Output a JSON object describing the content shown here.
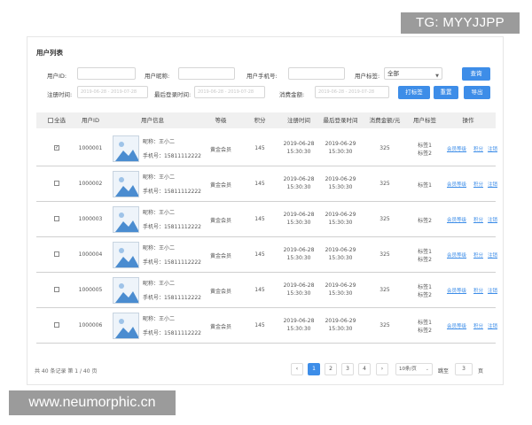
{
  "watermarks": {
    "top": "TG: MYYJJPP",
    "bottom": "www.neumorphic.cn"
  },
  "title": "用户列表",
  "filters": {
    "user_id_label": "用户ID:",
    "nickname_label": "用户昵称:",
    "phone_label": "用户手机号:",
    "tag_label": "用户标签:",
    "tag_value": "全部",
    "register_time_label": "注册时间:",
    "register_time_placeholder": "2019-06-28 - 2019-07-28",
    "last_login_label": "最后登录时间:",
    "last_login_placeholder": "2019-06-28 - 2019-07-28",
    "spend_label": "消费金额:",
    "spend_placeholder": "2019-06-28 - 2019-07-28"
  },
  "buttons": {
    "search": "查询",
    "tag": "打标签",
    "reset": "重置",
    "export": "导出"
  },
  "columns": {
    "select_all": "全选",
    "user_id": "用户ID",
    "user_info": "用户信息",
    "level": "等级",
    "points": "积分",
    "register_time": "注册时间",
    "last_login": "最后登录时间",
    "spend": "消费金额/元",
    "tags": "用户标签",
    "actions": "操作"
  },
  "rows": [
    {
      "checked": true,
      "id": "1000001",
      "nickname": "昵称：王小二",
      "phone": "手机号：15811112222",
      "level": "黄金会员",
      "points": "145",
      "reg_date": "2019-06-28",
      "reg_time": "15:30:30",
      "login_date": "2019-06-29",
      "login_time": "15:30:30",
      "spend": "325",
      "tag1": "标签1",
      "tag2": "标签2"
    },
    {
      "checked": false,
      "id": "1000002",
      "nickname": "昵称：王小二",
      "phone": "手机号：15811112222",
      "level": "黄金会员",
      "points": "145",
      "reg_date": "2019-06-28",
      "reg_time": "15:30:30",
      "login_date": "2019-06-29",
      "login_time": "15:30:30",
      "spend": "325",
      "tag1": "标签1",
      "tag2": ""
    },
    {
      "checked": false,
      "id": "1000003",
      "nickname": "昵称：王小二",
      "phone": "手机号：15811112222",
      "level": "黄金会员",
      "points": "145",
      "reg_date": "2019-06-28",
      "reg_time": "15:30:30",
      "login_date": "2019-06-29",
      "login_time": "15:30:30",
      "spend": "325",
      "tag1": "标签2",
      "tag2": ""
    },
    {
      "checked": false,
      "id": "1000004",
      "nickname": "昵称：王小二",
      "phone": "手机号：15811112222",
      "level": "黄金会员",
      "points": "145",
      "reg_date": "2019-06-28",
      "reg_time": "15:30:30",
      "login_date": "2019-06-29",
      "login_time": "15:30:30",
      "spend": "325",
      "tag1": "标签1",
      "tag2": "标签2"
    },
    {
      "checked": false,
      "id": "1000005",
      "nickname": "昵称：王小二",
      "phone": "手机号：15811112222",
      "level": "黄金会员",
      "points": "145",
      "reg_date": "2019-06-28",
      "reg_time": "15:30:30",
      "login_date": "2019-06-29",
      "login_time": "15:30:30",
      "spend": "325",
      "tag1": "标签1",
      "tag2": "标签2"
    },
    {
      "checked": false,
      "id": "1000006",
      "nickname": "昵称：王小二",
      "phone": "手机号：15811112222",
      "level": "黄金会员",
      "points": "145",
      "reg_date": "2019-06-28",
      "reg_time": "15:30:30",
      "login_date": "2019-06-29",
      "login_time": "15:30:30",
      "spend": "325",
      "tag1": "标签1",
      "tag2": "标签2"
    }
  ],
  "row_actions": {
    "level": "会员等级",
    "points": "积分",
    "cancel": "注销"
  },
  "footer": {
    "summary": "共 40 条记录 第 1 / 40 页",
    "prev": "‹",
    "next": "›",
    "pages": [
      "1",
      "2",
      "3",
      "4"
    ],
    "page_size": "10条/页",
    "goto_label": "跳至",
    "goto_value": "3",
    "goto_suffix": "页"
  },
  "colors": {
    "accent": "#3d8de8"
  }
}
